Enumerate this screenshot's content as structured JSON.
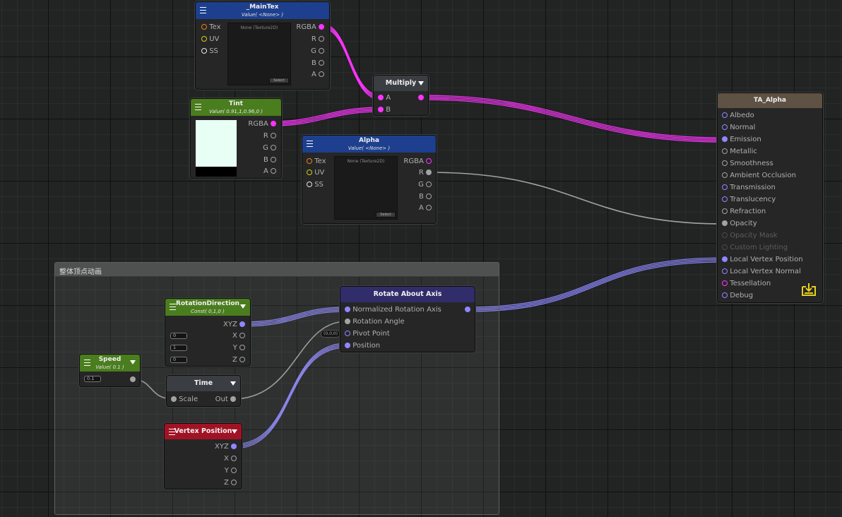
{
  "colors": {
    "magenta": "#ff33ff",
    "violet": "#8e88ff",
    "grey": "#a3a3a3",
    "tint_preview": "#e8fff6"
  },
  "group": {
    "title": "整体顶点动画"
  },
  "maintex": {
    "title": "_MainTex",
    "subtitle": "Value( <None> )",
    "inputs": [
      "Tex",
      "UV",
      "SS"
    ],
    "outputs": [
      "RGBA",
      "R",
      "G",
      "B",
      "A"
    ],
    "preview_label": "None (Texture2D)",
    "select_label": "Select"
  },
  "tint": {
    "title": "Tint",
    "subtitle": "Value( 0.91,1,0.96,0 )",
    "outputs": [
      "RGBA",
      "R",
      "G",
      "B",
      "A"
    ]
  },
  "alpha": {
    "title": "Alpha",
    "subtitle": "Value( <None> )",
    "inputs": [
      "Tex",
      "UV",
      "SS"
    ],
    "outputs": [
      "RGBA",
      "R",
      "G",
      "B",
      "A"
    ],
    "preview_label": "None (Texture2D)",
    "select_label": "Select"
  },
  "multiply": {
    "title": "Multiply",
    "inputs": [
      "A",
      "B"
    ]
  },
  "master": {
    "title": "TA_Alpha",
    "inputs": [
      "Albedo",
      "Normal",
      "Emission",
      "Metallic",
      "Smoothness",
      "Ambient Occlusion",
      "Transmission",
      "Translucency",
      "Refraction",
      "Opacity",
      "Opacity Mask",
      "Custom Lighting",
      "Local Vertex Position",
      "Local Vertex Normal",
      "Tessellation",
      "Debug"
    ]
  },
  "rotation_direction": {
    "title": "RotationDirection",
    "subtitle": "Const( 0,1,0 )",
    "outputs": [
      "XYZ",
      "X",
      "Y",
      "Z"
    ],
    "values": [
      "0",
      "1",
      "0"
    ]
  },
  "speed": {
    "title": "Speed",
    "subtitle": "Value( 0.1 )",
    "value": "0.1"
  },
  "time": {
    "title": "Time",
    "input": "Scale",
    "output": "Out"
  },
  "vertex_position": {
    "title": "Vertex Position",
    "outputs": [
      "XYZ",
      "X",
      "Y",
      "Z"
    ]
  },
  "rotate": {
    "title": "Rotate About Axis",
    "inputs": [
      "Normalized Rotation Axis",
      "Rotation Angle",
      "Pivot Point",
      "Position"
    ],
    "pivot_default": "(0,0,0)"
  }
}
